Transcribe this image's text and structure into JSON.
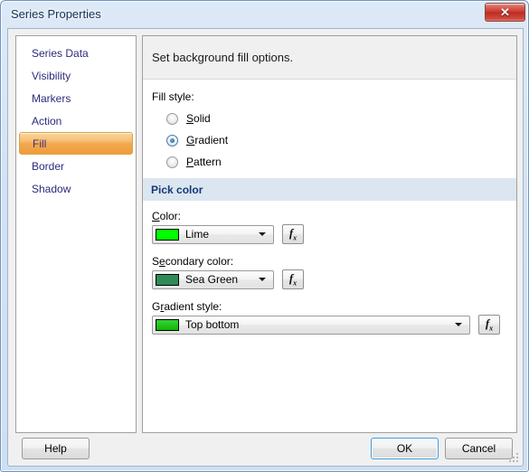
{
  "window": {
    "title": "Series Properties",
    "close_label": "✕"
  },
  "sidebar": {
    "items": [
      {
        "label": "Series Data",
        "selected": false
      },
      {
        "label": "Visibility",
        "selected": false
      },
      {
        "label": "Markers",
        "selected": false
      },
      {
        "label": "Action",
        "selected": false
      },
      {
        "label": "Fill",
        "selected": true
      },
      {
        "label": "Border",
        "selected": false
      },
      {
        "label": "Shadow",
        "selected": false
      }
    ]
  },
  "main": {
    "header": "Set background fill options.",
    "fill_style_label": "Fill style:",
    "radios": [
      {
        "label": "Solid",
        "accel": "S",
        "checked": false
      },
      {
        "label": "Gradient",
        "accel": "G",
        "checked": true
      },
      {
        "label": "Pattern",
        "accel": "P",
        "checked": false
      }
    ],
    "section_title": "Pick color",
    "fields": {
      "color": {
        "label": "Color:",
        "accel": "C",
        "value": "Lime",
        "swatch": "#00ff00",
        "fx_label": "fx"
      },
      "secondary_color": {
        "label": "Secondary color:",
        "accel": "e",
        "value": "Sea Green",
        "swatch": "#2e8b57",
        "fx_label": "fx"
      },
      "gradient_style": {
        "label": "Gradient style:",
        "accel": "r",
        "value": "Top bottom",
        "swatch_top": "#39d13b",
        "swatch_bottom": "#0fb800",
        "fx_label": "fx"
      }
    }
  },
  "buttons": {
    "help": "Help",
    "ok": "OK",
    "cancel": "Cancel"
  },
  "colors": {
    "accent_selected": "#ef9c3c",
    "section_header_bg": "#dce6f0",
    "section_header_text": "#123a77",
    "focus_border": "#3c9dda"
  }
}
